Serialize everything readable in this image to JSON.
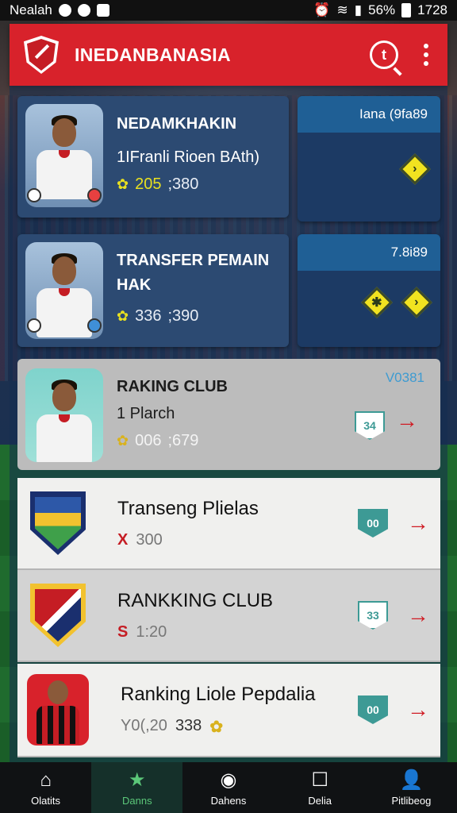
{
  "status": {
    "left_text": "Nealah",
    "right_text": "56%",
    "time": "1728"
  },
  "appbar": {
    "title": "INEDANBANASIA",
    "search_label": "t"
  },
  "cards": [
    {
      "title": "NEDAMKHAKIN",
      "subtitle": "1IFranli Rioen BAth)",
      "stat1": "205",
      "stat2": ";380",
      "side_header": "Iana (9fa89"
    },
    {
      "title_line1": "TRANSFER PEMAIN",
      "title_line2": "HAK",
      "stat1": "336",
      "stat2": ";390",
      "side_header": "7.8i89"
    },
    {
      "title": "RAKING CLUB",
      "subtitle": "1 Plarch",
      "stat1": "006",
      "stat2": ";679",
      "corner": "V0381",
      "badge": "34"
    }
  ],
  "list": [
    {
      "title": "Transeng Plielas",
      "prefix": "X",
      "value": "300",
      "badge": "00"
    },
    {
      "title": "RANKKING CLUB",
      "prefix": "S",
      "value": "1:20",
      "badge": "33"
    },
    {
      "title": "Ranking Liole Pepdalia",
      "value": "Y0(,20",
      "value2": "338",
      "badge": "00"
    }
  ],
  "bottom_nav": [
    "Olatits",
    "Danns",
    "Dahens",
    "Delia",
    "Pitlibeog"
  ],
  "colors": {
    "brand_red": "#d8222b",
    "card_blue": "#2c4a72",
    "accent_yellow": "#f1e320",
    "badge_teal": "#3d9a95"
  }
}
